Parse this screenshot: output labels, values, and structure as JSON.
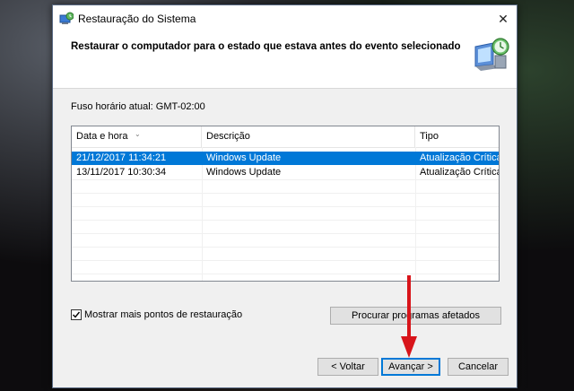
{
  "window": {
    "title": "Restauração do Sistema",
    "close_label": "✕"
  },
  "header": {
    "title": "Restaurar o computador para o estado que estava antes do evento selecionado"
  },
  "timezone_label": "Fuso horário atual: GMT-02:00",
  "table": {
    "columns": [
      "Data e hora",
      "Descrição",
      "Tipo"
    ],
    "rows": [
      {
        "date": "21/12/2017 11:34:21",
        "description": "Windows Update",
        "type": "Atualização Crítica",
        "selected": true
      },
      {
        "date": "13/11/2017 10:30:34",
        "description": "Windows Update",
        "type": "Atualização Crítica",
        "selected": false
      }
    ]
  },
  "show_more_checkbox": {
    "label": "Mostrar mais pontos de restauração",
    "checked": true
  },
  "buttons": {
    "scan_affected": "Procurar programas afetados",
    "back": "< Voltar",
    "next": "Avançar >",
    "cancel": "Cancelar"
  },
  "colors": {
    "selection": "#0078d7",
    "annotation_arrow": "#d8141a"
  },
  "icons": {
    "title": "system-restore-icon",
    "header": "system-restore-clock-icon",
    "checkbox": "checkmark-icon",
    "annotation": "red-arrow-down-icon"
  }
}
